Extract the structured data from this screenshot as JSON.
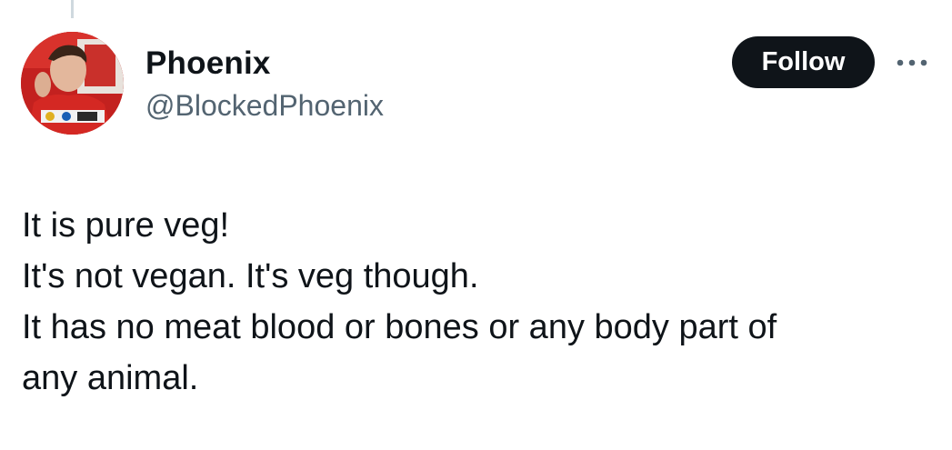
{
  "author": {
    "display_name": "Phoenix",
    "handle": "@BlockedPhoenix",
    "avatar_icon": "user-avatar-photo"
  },
  "actions": {
    "follow_label": "Follow",
    "more_icon": "more-horizontal-icon"
  },
  "tweet": {
    "lines": [
      "It is pure veg!",
      "It's not vegan. It's veg though.",
      "It has no meat blood or bones or any body part of",
      "any animal."
    ]
  },
  "colors": {
    "text_primary": "#0f1419",
    "text_secondary": "#536471",
    "button_bg": "#0f1419",
    "button_text": "#ffffff",
    "thread_line": "#cfd9de"
  }
}
